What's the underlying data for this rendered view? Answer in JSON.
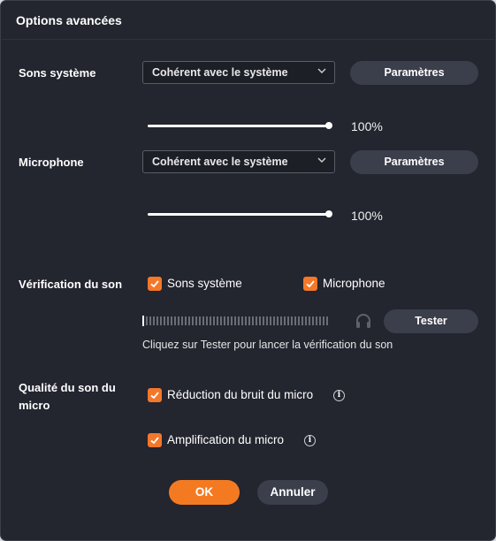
{
  "dialog": {
    "title": "Options avancées"
  },
  "system_sounds": {
    "label": "Sons système",
    "device": "Cohérent avec le système",
    "settings_label": "Paramètres",
    "volume_value": 1.0,
    "volume_text": "100%"
  },
  "microphone": {
    "label": "Microphone",
    "device": "Cohérent avec le système",
    "settings_label": "Paramètres",
    "volume_value": 1.0,
    "volume_text": "100%"
  },
  "sound_check": {
    "label": "Vérification du son",
    "option_system": {
      "label": "Sons système",
      "checked": true
    },
    "option_mic": {
      "label": "Microphone",
      "checked": true
    },
    "test_label": "Tester",
    "hint": "Cliquez sur Tester pour lancer la vérification du son",
    "level_value": 0.0
  },
  "mic_quality": {
    "label_line1": "Qualité du son du",
    "label_line2": "micro",
    "noise_reduction": {
      "label": "Réduction du bruit du micro",
      "checked": true
    },
    "amplification": {
      "label": "Amplification du micro",
      "checked": true
    }
  },
  "footer": {
    "ok_label": "OK",
    "cancel_label": "Annuler"
  },
  "icons": {
    "chevron": "chevron-down-icon",
    "check": "checkmark-icon",
    "headphones": "headphones-icon",
    "info": "info-icon"
  },
  "colors": {
    "background": "#23252f",
    "accent": "#f47a22",
    "button": "#3b3e4b"
  }
}
